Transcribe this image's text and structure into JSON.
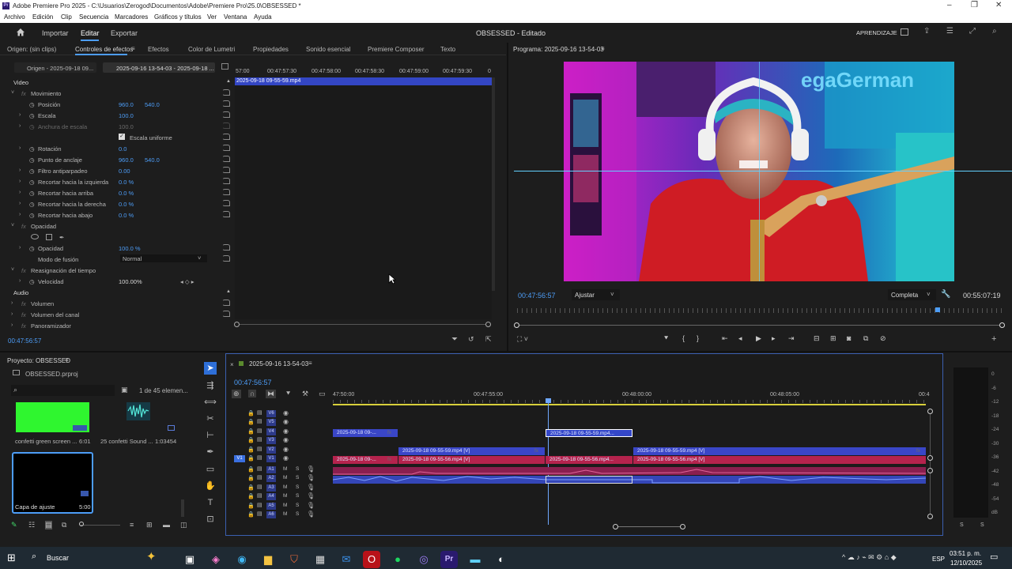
{
  "window": {
    "title": "Adobe Premiere Pro 2025 - C:\\Usuarios\\Zerogod\\Documentos\\Adobe\\Premiere Pro\\25.0\\OBSESSED *",
    "app_badge": "Pr"
  },
  "menu": [
    "Archivo",
    "Edición",
    "Clip",
    "Secuencia",
    "Marcadores",
    "Gráficos y títulos",
    "Ver",
    "Ventana",
    "Ayuda"
  ],
  "header": {
    "home": "home-icon",
    "tabs": [
      "Importar",
      "Editar",
      "Exportar"
    ],
    "active": "Editar",
    "project_title": "OBSESSED - Editado",
    "learn": "APRENDIZAJE"
  },
  "top_tabs": [
    "Origen: (sin clips)",
    "Controles de efectos",
    "Efectos",
    "Color de Lumetri",
    "Propiedades",
    "Sonido esencial",
    "Premiere Composer",
    "Texto"
  ],
  "effect_controls": {
    "source_tab": "Origen - 2025-09-18 09...",
    "seq_tab": "2025-09-16 13-54-03 - 2025-09-18 ...",
    "ruler": [
      "57:00",
      "00:47:57:30",
      "00:47:58:00",
      "00:47:58:30",
      "00:47:59:00",
      "00:47:59:30",
      "0"
    ],
    "clip_bar": "2025-09-18 09-55-59.mp4",
    "video_label": "Video",
    "motion": "Movimiento",
    "position": {
      "label": "Posición",
      "x": "960.0",
      "y": "540.0"
    },
    "scale": {
      "label": "Escala",
      "value": "100.0"
    },
    "scale_width": {
      "label": "Anchura de escala",
      "value": "100.0"
    },
    "uniform": "Escala uniforme",
    "rotation": {
      "label": "Rotación",
      "value": "0.0"
    },
    "anchor": {
      "label": "Punto de anclaje",
      "x": "960.0",
      "y": "540.0"
    },
    "flicker": {
      "label": "Filtro antiparpadeo",
      "value": "0.00"
    },
    "crop_left": {
      "label": "Recortar hacia la izquierda",
      "value": "0.0 %"
    },
    "crop_top": {
      "label": "Recortar hacia arriba",
      "value": "0.0 %"
    },
    "crop_right": {
      "label": "Recortar hacia la derecha",
      "value": "0.0 %"
    },
    "crop_bottom": {
      "label": "Recortar hacia abajo",
      "value": "0.0 %"
    },
    "opacity_group": "Opacidad",
    "opacity": {
      "label": "Opacidad",
      "value": "100.0 %"
    },
    "blend": {
      "label": "Modo de fusión",
      "value": "Normal"
    },
    "time_remap": "Reasignación del tiempo",
    "speed": {
      "label": "Velocidad",
      "value": "100.00%"
    },
    "audio_label": "Audio",
    "volume": "Volumen",
    "channel_volume": "Volumen del canal",
    "panner": "Panoramizador",
    "timecode": "00:47:56:57"
  },
  "program": {
    "title": "Programa: 2025-09-16 13-54-03",
    "timecode": "00:47:56:57",
    "fit": "Ajustar",
    "quality": "Completa",
    "duration": "00:55:07:19",
    "overlay_text": "egaGerman"
  },
  "project": {
    "title": "Proyecto: OBSESSED",
    "file": "OBSESSED.prproj",
    "count": "1 de 45 elemen...",
    "items": [
      {
        "name": "confetti green screen ...",
        "dur": "6:01"
      },
      {
        "name": "25 confetti Sound ...",
        "dur": "1:03454"
      },
      {
        "name": "Capa de ajuste",
        "dur": "5:00"
      }
    ]
  },
  "timeline": {
    "seq": "2025-09-16 13-54-03",
    "timecode": "00:47:56:57",
    "ruler": [
      "47:50:00",
      "00:47:55:00",
      "00:48:00:00",
      "00:48:05:00",
      "00:4"
    ],
    "playhead": 0.362,
    "tracks": [
      "V6",
      "V5",
      "V4",
      "V3",
      "V2",
      "V1",
      "A1",
      "A2",
      "A3",
      "A4",
      "A5",
      "A6"
    ],
    "clips": {
      "v4a": "2025-09-18 09-...",
      "v4b": "2025-09-18 09-55-59.mp4...",
      "v2a": "2025-09-18 09-55-59.mp4 [V]",
      "v2b": "2025-09-18 09-55-59.mp4 [V]",
      "v1a": "2025-09-18 09-...",
      "v1b": "2025-09-18 09-55-56.mp4 [V]",
      "v1c": "2025-09-18 09-55-56.mp4...",
      "v1d": "2025-09-18 09-55-56.mp4 [V]"
    },
    "fx": "fx"
  },
  "meter_ticks": [
    "0",
    "-6",
    "-12",
    "-18",
    "-24",
    "-30",
    "-36",
    "-42",
    "-48",
    "-54",
    "dB"
  ],
  "meter_solo": [
    "S",
    "S"
  ],
  "taskbar": {
    "search": "Buscar",
    "lang": "ESP",
    "time": "03:51 p. m.",
    "date": "12/10/2025"
  },
  "colors": {
    "accent": "#4d9df7",
    "clip_blue": "#3a46c7",
    "clip_red": "#b5234d",
    "selected_blue": "#3450d8"
  }
}
